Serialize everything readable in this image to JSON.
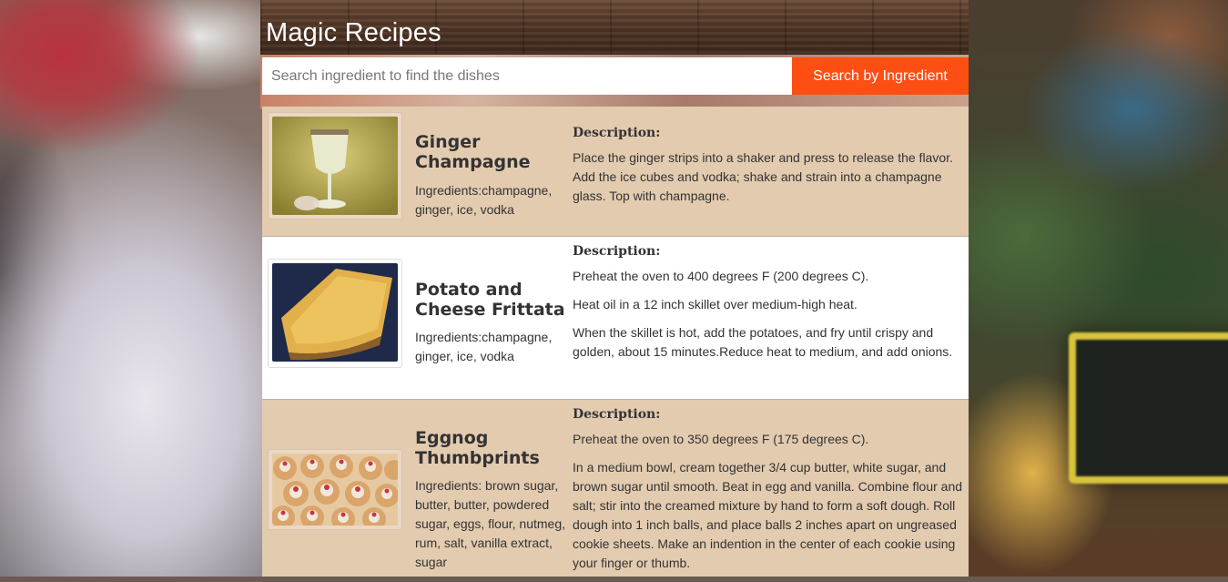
{
  "header": {
    "title": "Magic Recipes"
  },
  "search": {
    "placeholder": "Search ingredient to find the dishes",
    "value": "",
    "button_label": "Search by Ingredient",
    "button_color": "#fd4f13"
  },
  "recipes": [
    {
      "name": "Ginger Champagne",
      "ingredients": "Ingredients:champagne, ginger, ice, vodka",
      "description_label": "Description:",
      "description": [
        "Place the ginger strips into a shaker and press to release the flavor. Add the ice cubes and vodka; shake and strain into a champagne glass. Top with champagne."
      ]
    },
    {
      "name": "Potato and Cheese Frittata",
      "ingredients": "Ingredients:champagne, ginger, ice, vodka",
      "description_label": "Description:",
      "description": [
        "Preheat the oven to 400 degrees F (200 degrees C).",
        "Heat oil in a 12 inch skillet over medium-high heat.",
        "When the skillet is hot, add the potatoes, and fry until crispy and golden, about 15 minutes.Reduce heat to medium, and add onions."
      ]
    },
    {
      "name": "Eggnog Thumbprints",
      "ingredients": "Ingredients: brown sugar, butter, butter, powdered sugar, eggs, flour, nutmeg, rum, salt, vanilla extract, sugar",
      "description_label": "Description:",
      "description": [
        "Preheat the oven to 350 degrees F (175 degrees C).",
        "In a medium bowl, cream together 3/4 cup butter, white sugar, and brown sugar until smooth. Beat in egg and vanilla. Combine flour and salt; stir into the creamed mixture by hand to form a soft dough. Roll dough into 1 inch balls, and place balls 2 inches apart on ungreased cookie sheets. Make an indention in the center of each cookie using your finger or thumb."
      ]
    }
  ],
  "colors": {
    "card_tan": "#e3cbb0",
    "card_white": "#ffffff",
    "accent": "#fd4f13"
  }
}
